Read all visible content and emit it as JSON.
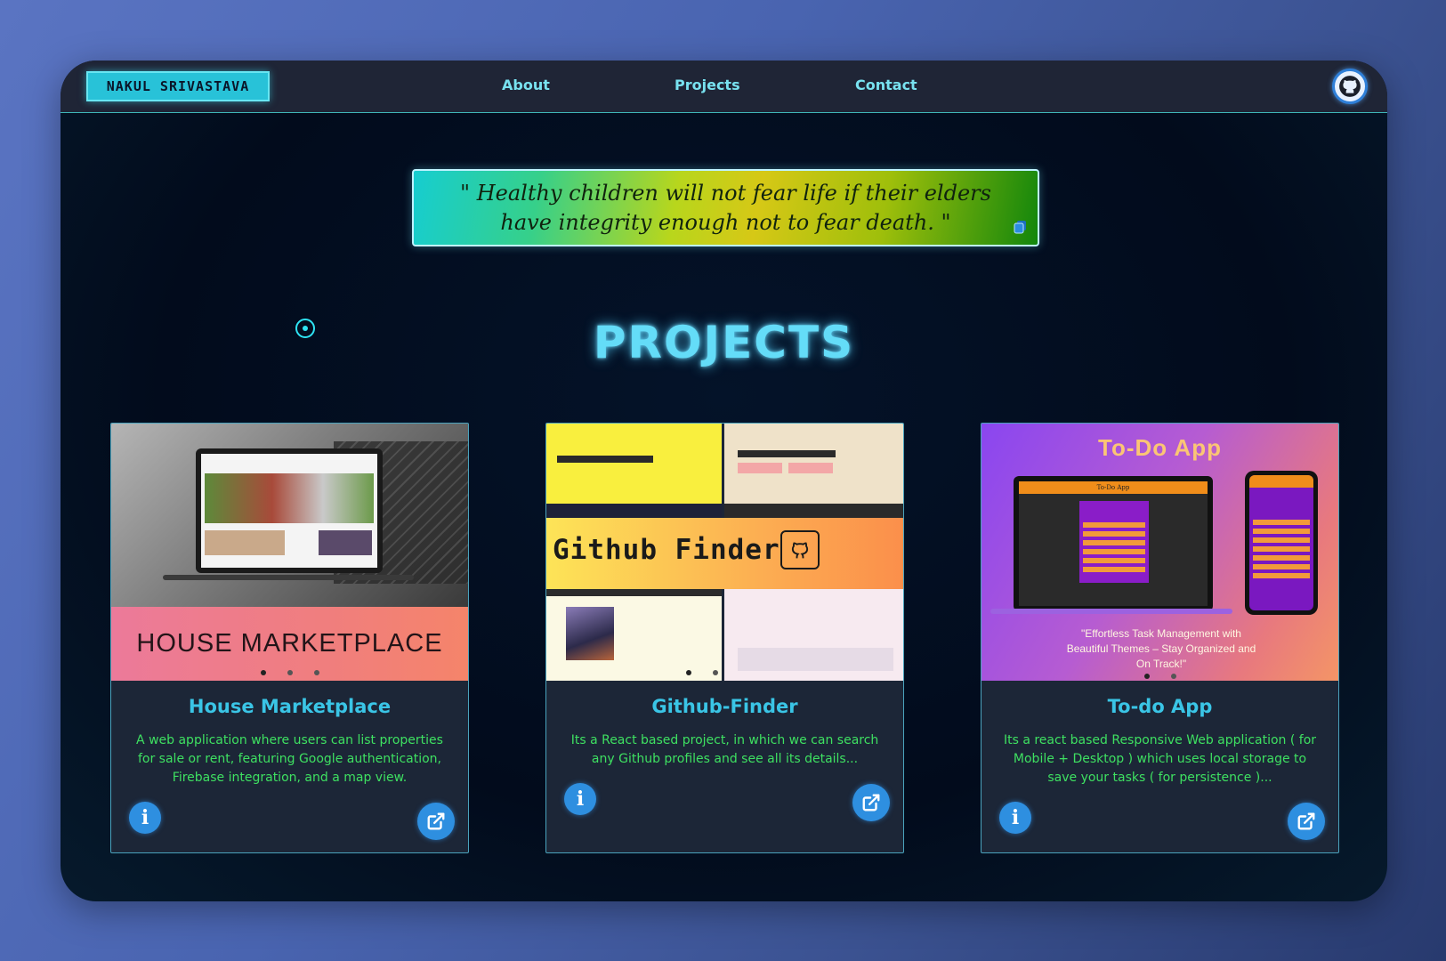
{
  "nav": {
    "brand": "NAKUL SRIVASTAVA",
    "links": [
      "About",
      "Projects",
      "Contact"
    ],
    "github_icon": "github-icon"
  },
  "quote": {
    "text": "\" Healthy children will not fear life if their elders have integrity enough not to fear death. \"",
    "copy_icon": "copy-icon"
  },
  "section": {
    "title": "PROJECTS"
  },
  "projects": [
    {
      "title": "House Marketplace",
      "banner": "HOUSE MARKETPLACE",
      "description": "A web application where users can list properties for sale or rent, featuring Google authentication, Firebase integration, and a map view."
    },
    {
      "title": "Github-Finder",
      "banner": "Github Finder",
      "description": "Its a React based project, in which we can search any Github profiles and see all its details..."
    },
    {
      "title": "To-do App",
      "banner": "To-Do App",
      "screen_title": "To-Do App",
      "tagline": "\"Effortless Task Management with Beautiful Themes – Stay Organized and On Track!\"",
      "description": "Its a react based Responsive Web application ( for Mobile + Desktop ) which uses local storage to save your tasks ( for persistence )..."
    }
  ],
  "colors": {
    "accent": "#64dcf8",
    "description": "#3ee061",
    "button": "#2e8fe0"
  }
}
